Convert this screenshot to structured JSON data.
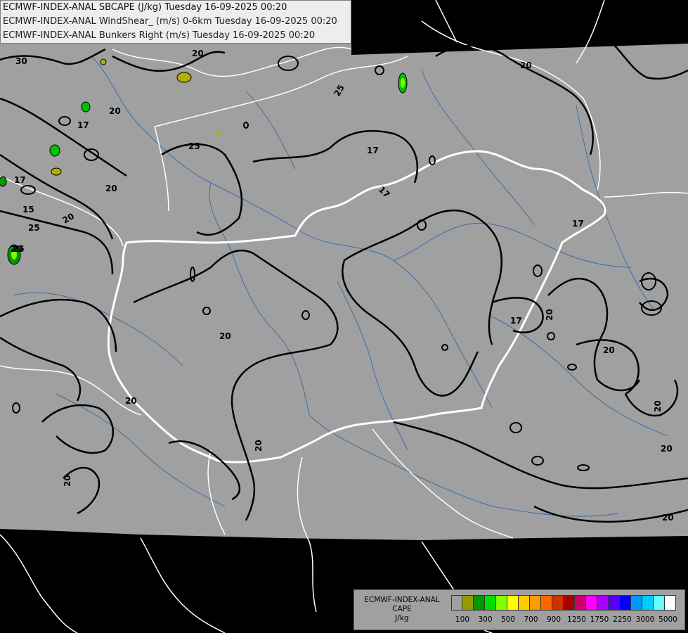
{
  "header": {
    "line1": "ECMWF-INDEX-ANAL SBCAPE (J/kg) Tuesday 16-09-2025 00:20",
    "line2": "ECMWF-INDEX-ANAL WindShear_ (m/s) 0-6km Tuesday 16-09-2025 00:20",
    "line3": "ECMWF-INDEX-ANAL Bunkers Right (m/s) Tuesday 16-09-2025 00:20"
  },
  "legend": {
    "title_line1": "ECMWF-INDEX-ANAL",
    "title_line2": "CAPE",
    "title_line3": "J/kg",
    "swatch_colors": [
      "#a0a0a0",
      "#9a9a00",
      "#009900",
      "#00e000",
      "#80ff00",
      "#ffff00",
      "#ffcc00",
      "#ff9900",
      "#ff6600",
      "#cc3300",
      "#aa0000",
      "#cc0066",
      "#ff00ff",
      "#aa00ff",
      "#5500ff",
      "#0000ff",
      "#0099ff",
      "#00ccff",
      "#66ffff",
      "#ffffff"
    ],
    "tick_labels": [
      "100",
      "300",
      "500",
      "700",
      "900",
      "1250",
      "1750",
      "2250",
      "3000",
      "5000"
    ]
  },
  "contour_labels": [
    "30",
    "20",
    "20",
    "25",
    "17",
    "20",
    "25",
    "20",
    "17",
    "25",
    "15",
    "20",
    "25",
    "17",
    "17",
    "17",
    "20",
    "20",
    "20",
    "20",
    "20",
    "20",
    "20",
    "20",
    "20",
    "17",
    "20"
  ],
  "colors": {
    "background": "#000000",
    "domain_fill": "#a0a0a0",
    "contour": "#000000",
    "border": "#ffffff",
    "river": "#3a6ea5"
  }
}
